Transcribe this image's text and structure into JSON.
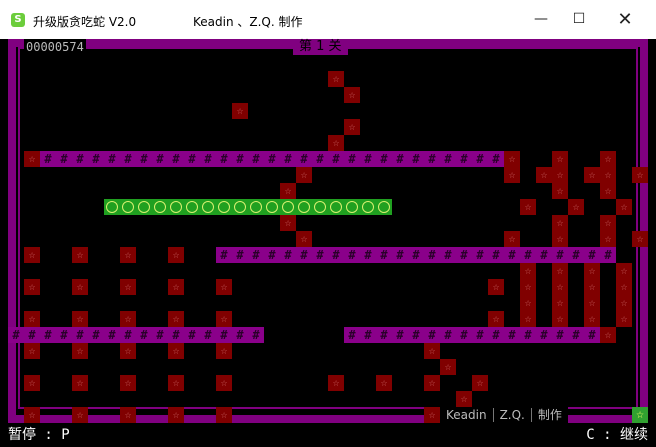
{
  "window": {
    "title": "升级版贪吃蛇 V2.0",
    "author": "Keadin 、Z.Q. 制作",
    "icon": "snake-app-icon",
    "icon_glyph": "S"
  },
  "titlebar_buttons": {
    "minimize": "—",
    "maximize": "☐",
    "close": "✕"
  },
  "hud": {
    "score": "00000574",
    "level": "第 1 关",
    "credits": [
      "Keadin",
      "Z.Q.",
      "制作"
    ]
  },
  "status": {
    "pause_hint": "暂停 : P",
    "continue_hint": "C : 继续"
  },
  "glyphs": {
    "brick": "☆",
    "wall": "#",
    "snake": "◎",
    "food": "☆"
  },
  "colors": {
    "frame": "#800080",
    "wall": "#8a008a",
    "brick": "#800000",
    "snake": "#20a020",
    "food": "#30a030"
  },
  "board": {
    "cols": 40,
    "rows": 24,
    "rows_map": [
      "                                        ",
      "                                        ",
      "                    B                   ",
      "                     B                  ",
      "              B                         ",
      "                     B                  ",
      "                    B                   ",
      " BWWWWWWWWWWWWWWWWWWWWWWWWWWWWWB  B  B  ",
      "                  B            B BB BB B",
      "                 B                B  B  ",
      "      SSSSSSSSSSSSSSSSSS        B  B  B ",
      "                 B                B  B  ",
      "                  B            B  B  B B",
      " B  B  B  B  WWWWWWWWWWWWWWWWWWWWWWWWW  ",
      "                                B B B B ",
      " B  B  B  B  B                B B B B B",
      "                                B B B B ",
      " B  B  B  B  B                B B B B B",
      "WWWWWWWWWWWWWWWW     WWWWWWWWWWWWWWWWB  ",
      " B  B  B  B  B            B             ",
      "                           B            ",
      " B  B  B  B  B      B  B  B  B          ",
      "                            B           ",
      " B  B  B  B  B            B            F"
    ]
  }
}
